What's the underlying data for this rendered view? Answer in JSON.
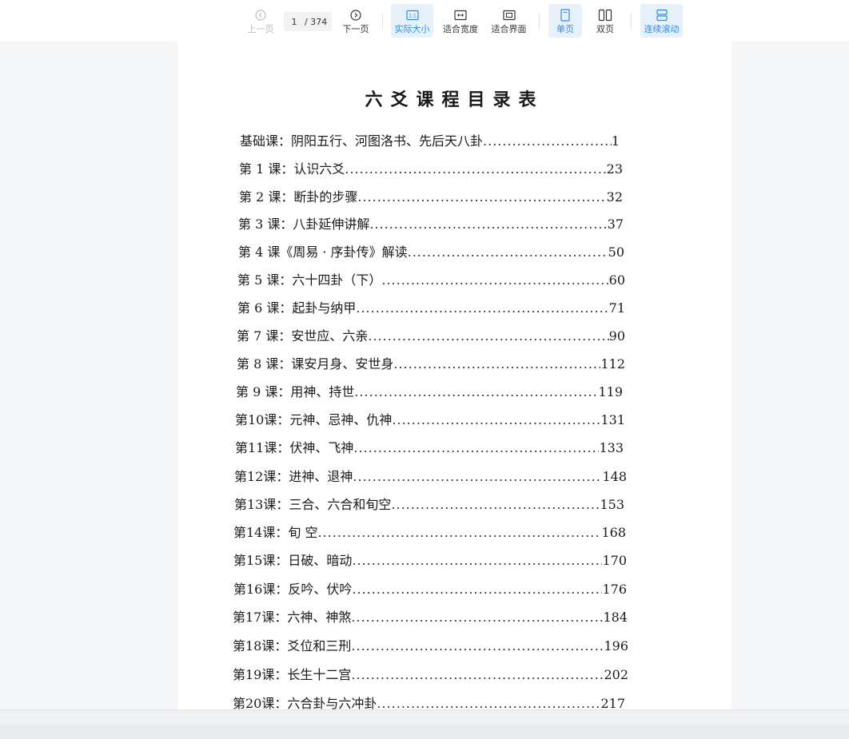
{
  "toolbar": {
    "prev_label": "上一页",
    "next_label": "下一页",
    "current_page": "1",
    "total_pages": "/ 374",
    "actual_size_label": "实际大小",
    "fit_width_label": "适合宽度",
    "fit_page_label": "适合界面",
    "single_page_label": "单页",
    "double_page_label": "双页",
    "continuous_label": "连续滚动",
    "accent_color": "#2a8cf0"
  },
  "document": {
    "title": "六爻课程目录表",
    "toc": [
      {
        "label": "基础课：",
        "title": "阴阳五行、河图洛书、先后天八卦",
        "page": " 1"
      },
      {
        "label": "第 1 课：",
        "title": "认识六爻",
        "page": "23"
      },
      {
        "label": "第 2 课：",
        "title": "断卦的步骤",
        "page": "32"
      },
      {
        "label": "第 3 课：",
        "title": "八卦延伸讲解",
        "page": "37"
      },
      {
        "label": "第 4 课",
        "title": "《周易 · 序卦传》解读",
        "page": "50"
      },
      {
        "label": "第 5 课：",
        "title": "六十四卦（下）",
        "page": "60"
      },
      {
        "label": "第 6 课：",
        "title": "起卦与纳甲",
        "page": "71"
      },
      {
        "label": "第 7 课：",
        "title": "安世应、六亲",
        "page": "90"
      },
      {
        "label": "第 8 课：",
        "title": "课安月身、安世身",
        "page": "112"
      },
      {
        "label": "第 9 课：",
        "title": "用神、持世",
        "page": "119"
      },
      {
        "label": "第10课：",
        "title": "元神、忌神、仇神",
        "page": "131"
      },
      {
        "label": "第11课：",
        "title": "伏神、飞神",
        "page": "133"
      },
      {
        "label": "第12课：",
        "title": "进神、退神",
        "page": "148"
      },
      {
        "label": "第13课：",
        "title": "三合、六合和旬空",
        "page": "153"
      },
      {
        "label": "第14课：",
        "title": "旬  空",
        "page": "168"
      },
      {
        "label": "第15课：",
        "title": "日破、暗动",
        "page": "170"
      },
      {
        "label": "第16课：",
        "title": "反吟、伏吟",
        "page": "176"
      },
      {
        "label": "第17课：",
        "title": "六神、神煞",
        "page": "184"
      },
      {
        "label": "第18课：",
        "title": "爻位和三刑",
        "page": "196"
      },
      {
        "label": "第19课：",
        "title": "长生十二宫",
        "page": "202"
      },
      {
        "label": "第20课：",
        "title": "六合卦与六冲卦",
        "page": "217"
      }
    ]
  }
}
